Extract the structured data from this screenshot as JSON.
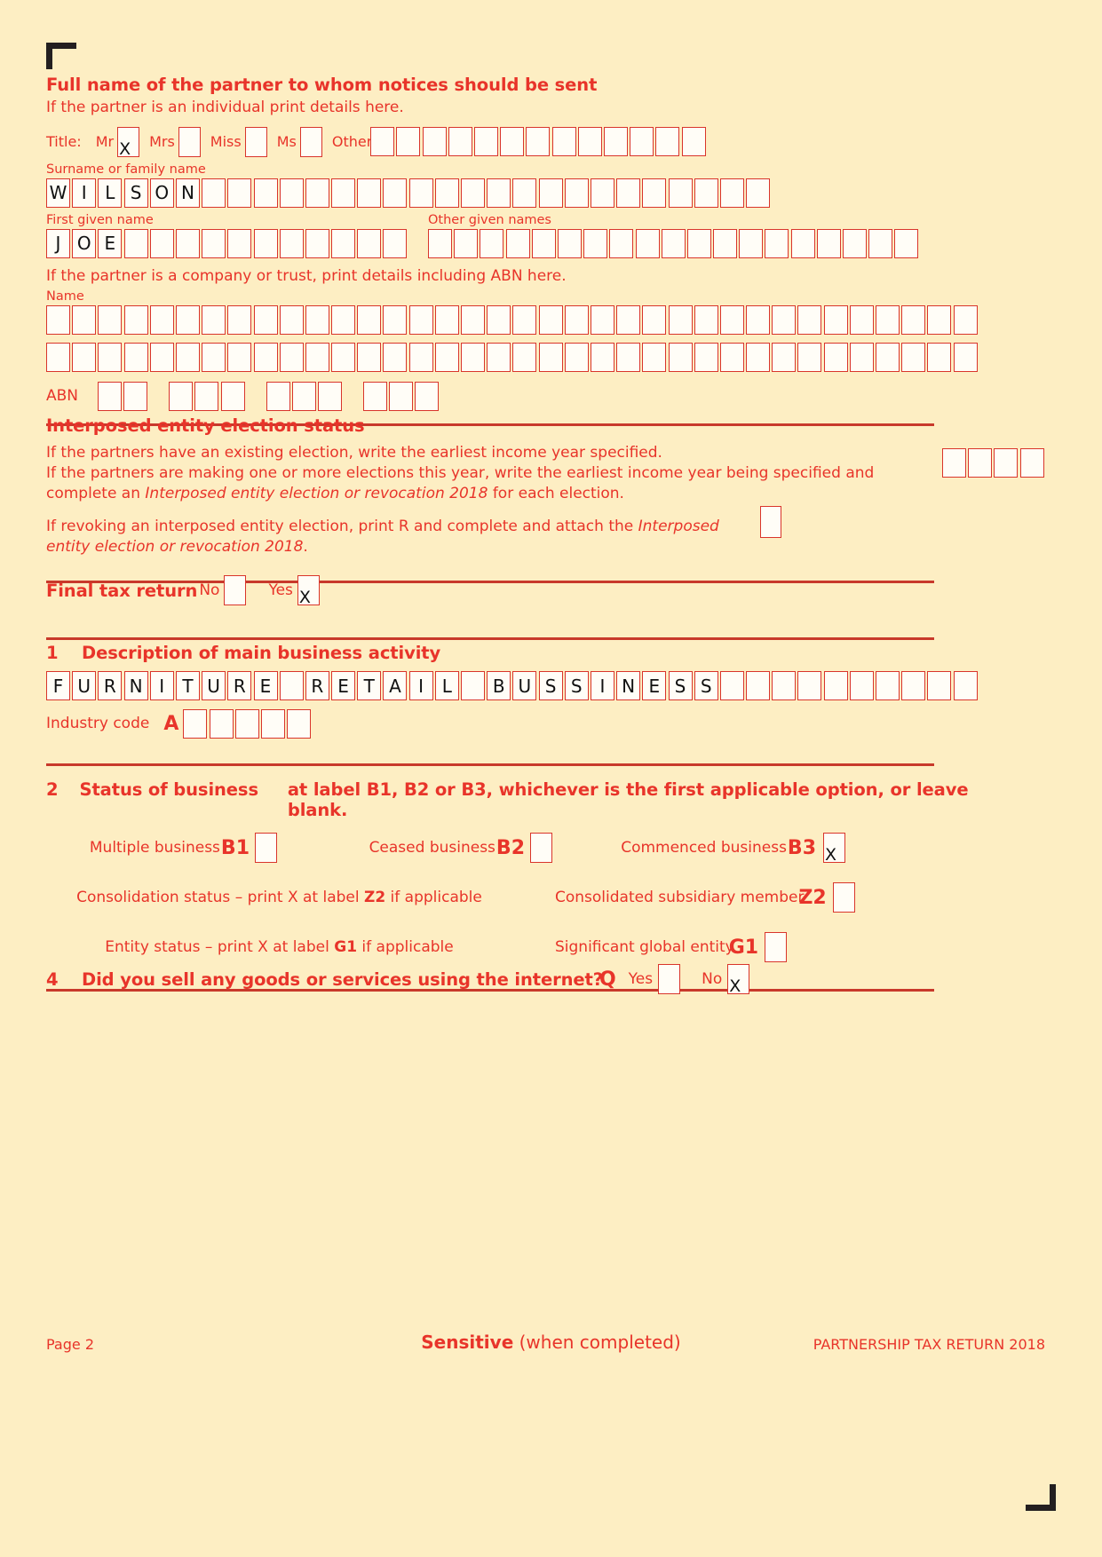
{
  "section_partner": {
    "heading": "Full name of the partner to whom notices should be sent",
    "individual_note": "If the partner is an individual print details here.",
    "title_label": "Title:",
    "titles": [
      {
        "label": "Mr",
        "value": "X"
      },
      {
        "label": "Mrs",
        "value": ""
      },
      {
        "label": "Miss",
        "value": ""
      },
      {
        "label": "Ms",
        "value": ""
      }
    ],
    "other_label": "Other",
    "other_boxes": 13,
    "surname_label": "Surname or family name",
    "surname_value": "WILSON",
    "surname_boxes": 28,
    "first_name_label": "First given name",
    "first_name_value": "JOE",
    "first_name_boxes": 14,
    "other_given_label": "Other given names",
    "other_given_value": "",
    "other_given_boxes": 19,
    "company_note": "If the partner is a company or trust, print details including ABN here.",
    "name_label": "Name",
    "name_line1_value": "",
    "name_line1_boxes": 36,
    "name_line2_value": "",
    "name_line2_boxes": 36,
    "abn_label": "ABN",
    "abn_groups": [
      2,
      3,
      3,
      3
    ],
    "abn_value": ""
  },
  "section_interposed": {
    "heading": "Interposed entity election status",
    "line1": "If the partners have an existing election, write the earliest income year specified.",
    "line2": "If the partners are making one or more elections this year, write the earliest income year being specified and",
    "line3_pre": "complete an ",
    "line3_italic": "Interposed entity election or revocation 2018",
    "line3_post": " for each election.",
    "year_boxes": 4,
    "year_value": "",
    "revoke_pre": "If revoking an interposed entity election, print R and complete and attach the ",
    "revoke_italic1": "Interposed",
    "revoke_italic2": "entity election or revocation 2018",
    "revoke_post": ".",
    "revoke_value": ""
  },
  "section_final": {
    "label": "Final tax return",
    "no_label": "No",
    "no_value": "",
    "yes_label": "Yes",
    "yes_value": "X"
  },
  "section_1": {
    "number": "1",
    "heading": "Description of main business activity",
    "activity_value": "FURNITURE RETAIL BUSSINESS",
    "activity_boxes": 36,
    "industry_code_label": "Industry code",
    "industry_code_letter": "A",
    "industry_code_boxes": 5,
    "industry_code_value": ""
  },
  "section_2": {
    "number": "2",
    "heading": "Status of business",
    "instruction": "at label B1, B2 or B3, whichever is the first applicable option, or leave blank.",
    "options": [
      {
        "label": "Multiple business",
        "code": "B1",
        "value": ""
      },
      {
        "label": "Ceased business",
        "code": "B2",
        "value": ""
      },
      {
        "label": "Commenced business",
        "code": "B3",
        "value": "X"
      }
    ],
    "consolidation_left_pre": "Consolidation status – print X at label ",
    "consolidation_left_code": "Z2",
    "consolidation_left_post": " if applicable",
    "consolidation_right_label": "Consolidated subsidiary member",
    "consolidation_right_code": "Z2",
    "consolidation_right_value": "",
    "entity_left_pre": "Entity status – print X at label ",
    "entity_left_code": "G1",
    "entity_left_post": " if applicable",
    "entity_right_label": "Significant global entity",
    "entity_right_code": "G1",
    "entity_right_value": ""
  },
  "section_4": {
    "number": "4",
    "heading": "Did you sell any goods or services using the internet?",
    "code": "Q",
    "yes_label": "Yes",
    "yes_value": "",
    "no_label": "No",
    "no_value": "X"
  },
  "footer": {
    "page": "Page 2",
    "sensitive_bold": "Sensitive",
    "sensitive_rest": " (when completed)",
    "doc_title": "PARTNERSHIP TAX RETURN 2018"
  },
  "colors": {
    "bg": "#fdeec3",
    "red": "#e8342a",
    "rule": "#c8392b",
    "box_border": "#d9352b",
    "box_fill": "#fffdf7",
    "mark": "#111111"
  }
}
